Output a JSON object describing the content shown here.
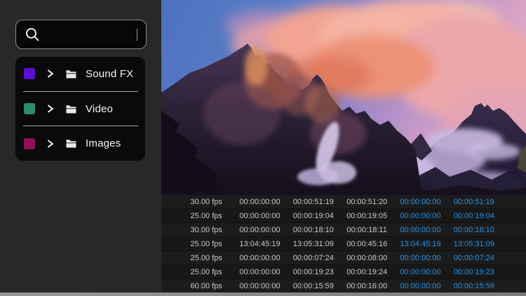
{
  "accent": {
    "timecode_blue": "#2793e6"
  },
  "sidebar": {
    "search": {
      "value": "",
      "placeholder": ""
    },
    "folders": [
      {
        "label": "Sound FX",
        "color": "#5a10d0"
      },
      {
        "label": "Video",
        "color": "#2d8c6c"
      },
      {
        "label": "Images",
        "color": "#8f1057"
      }
    ]
  },
  "preview": {
    "description": "Mountain peak at sunset with pink clouds"
  },
  "clip_table": {
    "rows": [
      [
        "30.00 fps",
        "00:00:00:00",
        "00:00:51:19",
        "00:00:51:20",
        "00:00:00:00",
        "00:00:51:19"
      ],
      [
        "25.00 fps",
        "00:00:00:00",
        "00:00:19:04",
        "00:00:19:05",
        "00:00:00:00",
        "00:00:19:04"
      ],
      [
        "30.00 fps",
        "00:00:00:00",
        "00:00:18:10",
        "00:00:18:11",
        "00:00:00:00",
        "00:00:18:10"
      ],
      [
        "25.00 fps",
        "13:04:45:19",
        "13:05:31:09",
        "00:00:45:16",
        "13:04:45:19",
        "13:05:31:09"
      ],
      [
        "25.00 fps",
        "00:00:00:00",
        "00:00:07:24",
        "00:00:08:00",
        "00:00:00:00",
        "00:00:07:24"
      ],
      [
        "25.00 fps",
        "00:00:00:00",
        "00:00:19:23",
        "00:00:19:24",
        "00:00:00:00",
        "00:00:19:23"
      ],
      [
        "60.00 fps",
        "00:00:00:00",
        "00:00:15:59",
        "00:00:16:00",
        "00:00:00:00",
        "00:00:15:59"
      ]
    ]
  }
}
